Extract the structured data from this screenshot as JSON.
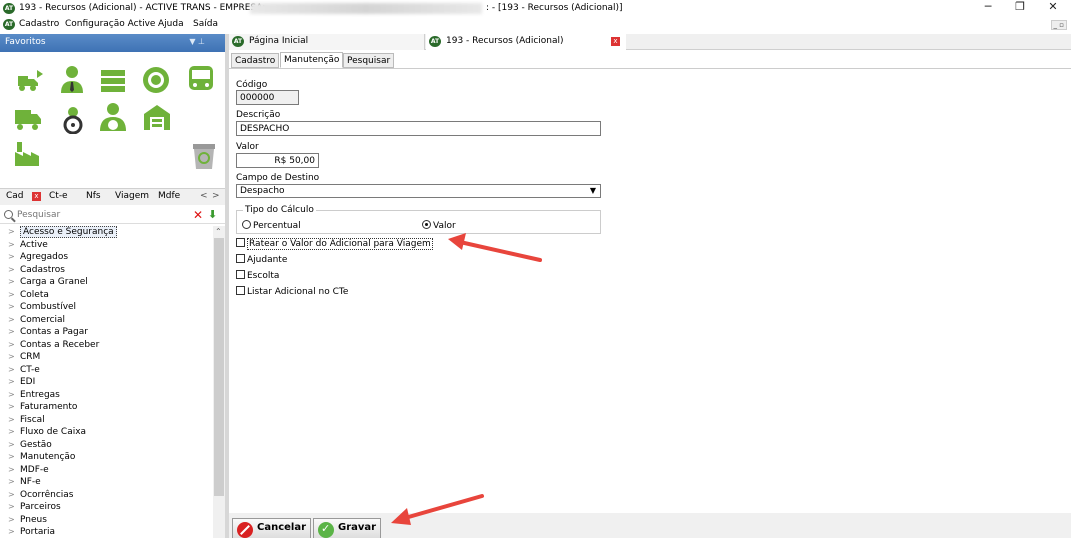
{
  "window": {
    "title": "193 - Recursos (Adicional) - ACTIVE TRANS - EMPRESA:",
    "title_suffix": ": - [193 - Recursos (Adicional)]",
    "logo_text": "AT",
    "minimize": "─",
    "restore": "❐",
    "close": "✕"
  },
  "menu": {
    "items": [
      "Cadastro",
      "Configuração Active",
      "Ajuda",
      "Saída"
    ],
    "mdi_controls": "_ ▫"
  },
  "favorites": {
    "title": "Favoritos",
    "pin": "▼ ⊥",
    "icons": [
      "add-truck-icon",
      "driver-icon",
      "fleet-icon",
      "wheel-icon",
      "bus-icon",
      "truck-icon",
      "steering-wheel-icon",
      "user-car-icon",
      "warehouse-icon",
      "factory-icon",
      "recycle-bin-icon"
    ]
  },
  "left_tabs": {
    "items": [
      "Cad",
      "Ct-e",
      "Nfs",
      "Viagem",
      "Mdfe"
    ],
    "close": "x",
    "nav_prev": "<",
    "nav_next": ">"
  },
  "search": {
    "placeholder": "Pesquisar"
  },
  "tree": {
    "items": [
      "Acesso e Segurança",
      "Active",
      "Agregados",
      "Cadastros",
      "Carga a Granel",
      "Coleta",
      "Combustível",
      "Comercial",
      "Contas a Pagar",
      "Contas a Receber",
      "CRM",
      "CT-e",
      "EDI",
      "Entregas",
      "Faturamento",
      "Fiscal",
      "Fluxo de Caixa",
      "Gestão",
      "Manutenção",
      "MDF-e",
      "NF-e",
      "Ocorrências",
      "Parceiros",
      "Pneus",
      "Portaria"
    ]
  },
  "doc_tabs": {
    "home": "Página Inicial",
    "current": "193 - Recursos (Adicional)",
    "close": "x"
  },
  "sub_tabs": [
    "Cadastro",
    "Manutenção",
    "Pesquisar"
  ],
  "form": {
    "codigo_label": "Código",
    "codigo_value": "000000",
    "descricao_label": "Descrição",
    "descricao_value": "DESPACHO",
    "valor_label": "Valor",
    "valor_value": "R$ 50,00",
    "destino_label": "Campo de Destino",
    "destino_value": "Despacho",
    "calculo_label": "Tipo do Cálculo",
    "radio_percentual": "Percentual",
    "radio_valor": "Valor",
    "check_ratear": "Ratear o Valor do Adicional para Viagem",
    "check_ajudante": "Ajudante",
    "check_escolta": "Escolta",
    "check_listar": "Listar Adicional no CTe"
  },
  "footer": {
    "cancel": "Cancelar",
    "save": "Gravar"
  },
  "colors": {
    "annotation_arrow": "#e8453c",
    "favorites_header": "#3e72b4",
    "icon_green": "#6fb23a"
  }
}
